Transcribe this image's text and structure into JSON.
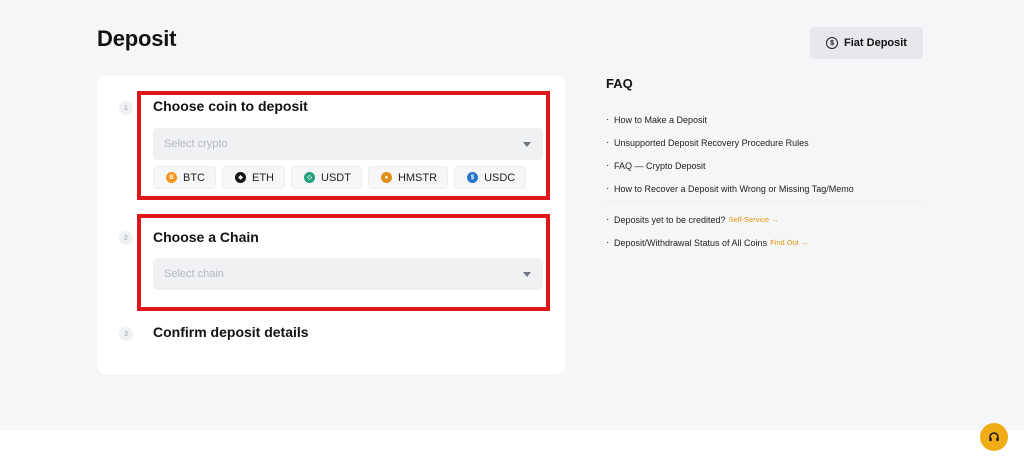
{
  "header": {
    "title": "Deposit",
    "fiat_button_label": "Fiat Deposit",
    "fiat_icon_glyph": "$"
  },
  "steps": [
    {
      "number": "1",
      "title": "Choose coin to deposit",
      "select_placeholder": "Select crypto"
    },
    {
      "number": "2",
      "title": "Choose a Chain",
      "select_placeholder": "Select chain"
    },
    {
      "number": "3",
      "title": "Confirm deposit details"
    }
  ],
  "coins": [
    {
      "label": "BTC",
      "icon": "btc-icon",
      "color": "#f7931a",
      "glyph": "B"
    },
    {
      "label": "ETH",
      "icon": "eth-icon",
      "color": "#141414",
      "glyph": "◆"
    },
    {
      "label": "USDT",
      "icon": "usdt-icon",
      "color": "#26a17b",
      "glyph": "◇"
    },
    {
      "label": "HMSTR",
      "icon": "hmstr-icon",
      "color": "#e0901a",
      "glyph": "●"
    },
    {
      "label": "USDC",
      "icon": "usdc-icon",
      "color": "#2775ca",
      "glyph": "$"
    }
  ],
  "faq": {
    "title": "FAQ",
    "items": [
      "How to Make a Deposit",
      "Unsupported Deposit Recovery Procedure Rules",
      "FAQ — Crypto Deposit",
      "How to Recover a Deposit with Wrong or Missing Tag/Memo"
    ],
    "extra": [
      {
        "text": "Deposits yet to be credited?",
        "link": "Self-Service →"
      },
      {
        "text": "Deposit/Withdrawal Status of All Coins",
        "link": "Find Out →"
      }
    ]
  },
  "colors": {
    "highlight_box": "#e0161b",
    "accent": "#e8950c",
    "support_button": "#f0ac15"
  },
  "support": {
    "icon": "headset-icon"
  }
}
